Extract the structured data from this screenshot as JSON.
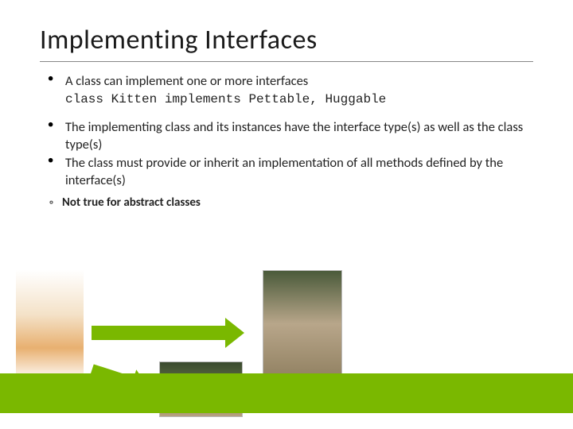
{
  "title": "Implementing Interfaces",
  "bullets": {
    "b1": "A class can implement one or more interfaces",
    "b1code": "class Kitten implements Pettable, Huggable",
    "b2": "The implementing class and its instances have the interface type(s) as well as the class type(s)",
    "b3": "The class must provide or inherit an implementation of all methods defined by the interface(s)"
  },
  "sub": {
    "s1": "Not true for abstract classes"
  }
}
